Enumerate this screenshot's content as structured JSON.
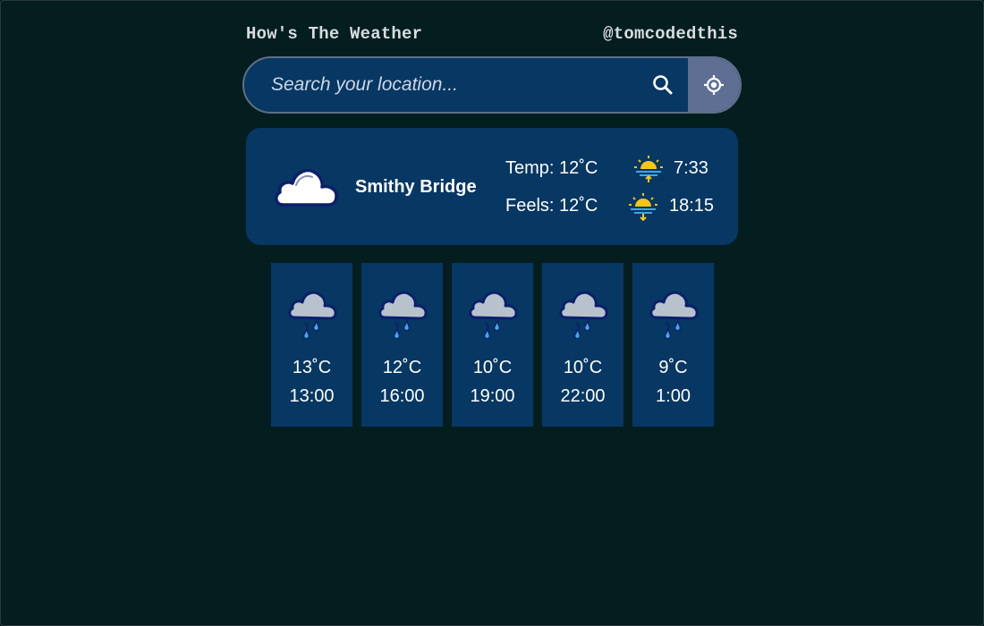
{
  "header": {
    "title": "How's The Weather",
    "author": "@tomcodedthis"
  },
  "search": {
    "placeholder": "Search your location...",
    "value": ""
  },
  "current": {
    "icon": "cloud-icon",
    "location": "Smithy Bridge",
    "temp": "Temp: 12˚C",
    "feels": "Feels: 12˚C",
    "sunrise": "7:33",
    "sunset": "18:15"
  },
  "forecast": [
    {
      "icon": "rain-cloud-icon",
      "temp": "13˚C",
      "time": "13:00"
    },
    {
      "icon": "rain-cloud-icon",
      "temp": "12˚C",
      "time": "16:00"
    },
    {
      "icon": "rain-cloud-icon",
      "temp": "10˚C",
      "time": "19:00"
    },
    {
      "icon": "rain-cloud-icon",
      "temp": "10˚C",
      "time": "22:00"
    },
    {
      "icon": "rain-cloud-icon",
      "temp": "9˚C",
      "time": "1:00"
    }
  ],
  "colors": {
    "background": "#041e20",
    "panel": "#073763",
    "locate_button": "#5e6f93",
    "header_text": "#d8dce0",
    "sun": "#f5c518",
    "raindrop": "#3fa9e0"
  }
}
